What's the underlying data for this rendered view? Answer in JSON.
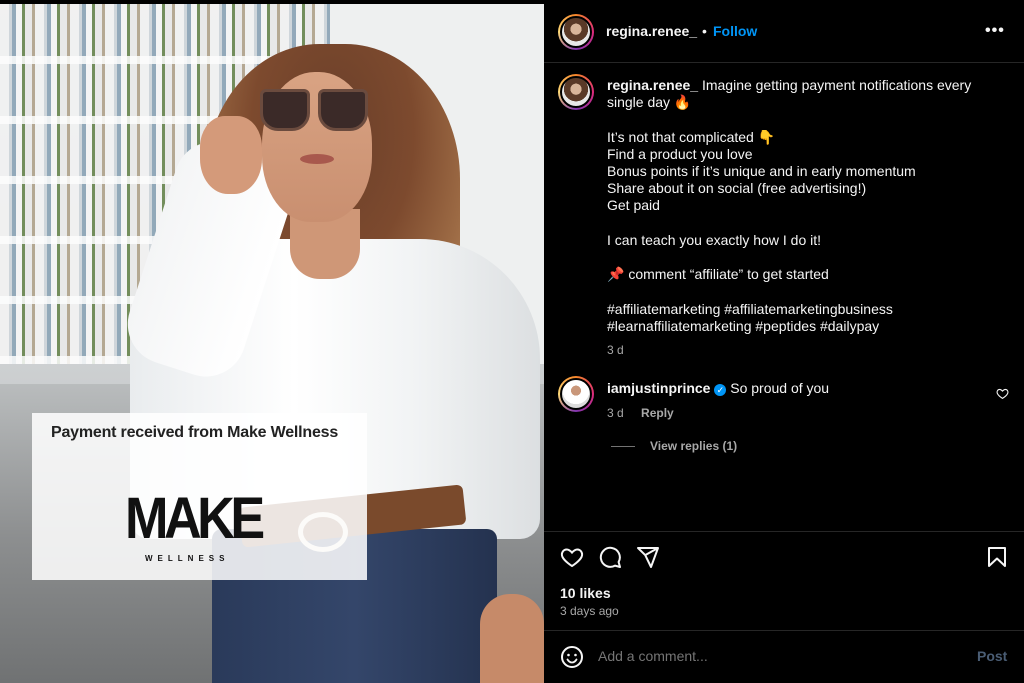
{
  "post_image": {
    "card_title": "Payment received from Make Wellness",
    "logo_main": "MAKE",
    "logo_sub": "WELLNESS"
  },
  "header": {
    "username": "regina.renee_",
    "separator": "•",
    "follow_label": "Follow",
    "more_label": "•••"
  },
  "caption": {
    "username": "regina.renee_",
    "lines": [
      "Imagine getting payment notifications every single day 🔥",
      "",
      "It’s not that complicated 👇",
      "Find a product you love",
      "Bonus points if it’s unique and in early momentum",
      "Share about it on social (free advertising!)",
      "Get paid",
      "",
      "I can teach you exactly how I do it!",
      "",
      "📌 comment “affiliate” to get started",
      "",
      "#affiliatemarketing #affiliatemarketingbusiness #learnaffiliatemarketing #peptides #dailypay"
    ],
    "time": "3 d"
  },
  "comment": {
    "username": "iamjustinprince",
    "text": "So proud of you",
    "time": "3 d",
    "reply_label": "Reply",
    "view_replies": "View replies (1)"
  },
  "footer": {
    "likes": "10 likes",
    "ago": "3 days ago",
    "comment_placeholder": "Add a comment...",
    "post_label": "Post"
  },
  "colors": {
    "link_blue": "#0095f6",
    "background": "#000000",
    "text": "#f5f5f5",
    "muted": "#a8a8a8"
  },
  "icons": [
    "heart-icon",
    "comment-icon",
    "share-icon",
    "bookmark-icon",
    "emoji-icon",
    "verified-icon",
    "more-icon"
  ]
}
